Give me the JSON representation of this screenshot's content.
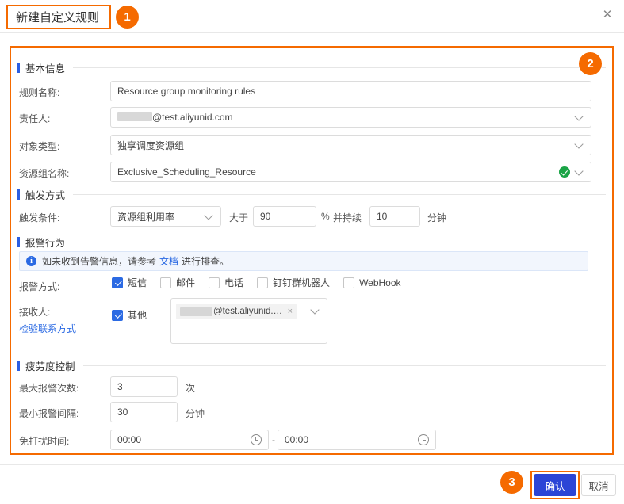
{
  "dialog": {
    "title": "新建自定义规则",
    "close_icon": "close-icon"
  },
  "step_badges": {
    "one": "1",
    "two": "2",
    "three": "3"
  },
  "sections": {
    "basic": {
      "title": "基本信息",
      "fields": {
        "rule_name": {
          "label": "规则名称:",
          "value": "Resource group monitoring rules"
        },
        "owner": {
          "label": "责任人:",
          "value": "@test.aliyunid.com",
          "redacted": true
        },
        "object_type": {
          "label": "对象类型:",
          "value": "独享调度资源组"
        },
        "resource_group": {
          "label": "资源组名称:",
          "value": "Exclusive_Scheduling_Resource",
          "validated": true
        }
      }
    },
    "trigger": {
      "title": "触发方式",
      "condition_label": "触发条件:",
      "metric": "资源组利用率",
      "operator": "大于",
      "threshold": "90",
      "percent_unit": "%",
      "duration_prefix": "并持续",
      "duration": "10",
      "duration_unit": "分钟"
    },
    "alarm": {
      "title": "报警行为",
      "notice_prefix": "如未收到告警信息，请参考",
      "notice_link": "文档",
      "notice_suffix": "进行排查。",
      "method_label": "报警方式:",
      "methods": [
        {
          "label": "短信",
          "checked": true
        },
        {
          "label": "邮件",
          "checked": false
        },
        {
          "label": "电话",
          "checked": false
        },
        {
          "label": "钉钉群机器人",
          "checked": false
        },
        {
          "label": "WebHook",
          "checked": false
        }
      ],
      "receiver_label": "接收人:",
      "verify_contact_link": "检验联系方式",
      "other_option": {
        "label": "其他",
        "checked": true
      },
      "receiver_tag": "@test.aliyunid.c...",
      "receiver_tag_remove": "×"
    },
    "fatigue": {
      "title": "疲劳度控制",
      "max_count_label": "最大报警次数:",
      "max_count_value": "3",
      "max_count_unit": "次",
      "min_interval_label": "最小报警间隔:",
      "min_interval_value": "30",
      "min_interval_unit": "分钟",
      "quiet_label": "免打扰时间:",
      "quiet_start": "00:00",
      "quiet_end": "00:00",
      "quiet_separator": "-"
    }
  },
  "footer": {
    "confirm": "确认",
    "cancel": "取消"
  },
  "colors": {
    "highlight": "#f56a00",
    "primary": "#2b45d6",
    "link": "#2b6ae3",
    "section_bar": "#2b5fe3",
    "success": "#1aa446"
  }
}
